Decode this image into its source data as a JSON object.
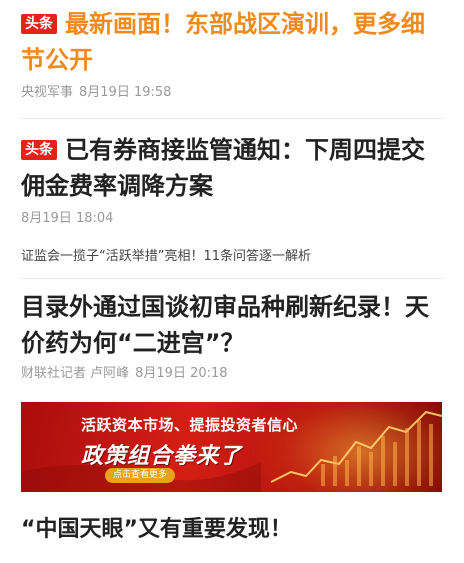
{
  "items": [
    {
      "tag": "头条",
      "title": "最新画面！东部战区演训，更多细节公开",
      "source": "央视军事",
      "date": "8月19日 19:58"
    },
    {
      "tag": "头条",
      "title": "已有券商接监管通知：下周四提交佣金费率调降方案",
      "date": "8月19日 18:04",
      "subtitle": "证监会一揽子“活跃举措”亮相！11条问答逐一解析"
    },
    {
      "title": "目录外通过国谈初审品种刷新纪录！天价药为何“二进宫”？",
      "source": "财联社记者 卢阿峰",
      "date": "8月19日 20:18"
    },
    {
      "title": "“中国天眼”又有重要发现！"
    }
  ],
  "banner": {
    "line1": "活跃资本市场、提振投资者信心",
    "line2": "政策组合拳来了",
    "button": "点击查看更多"
  }
}
